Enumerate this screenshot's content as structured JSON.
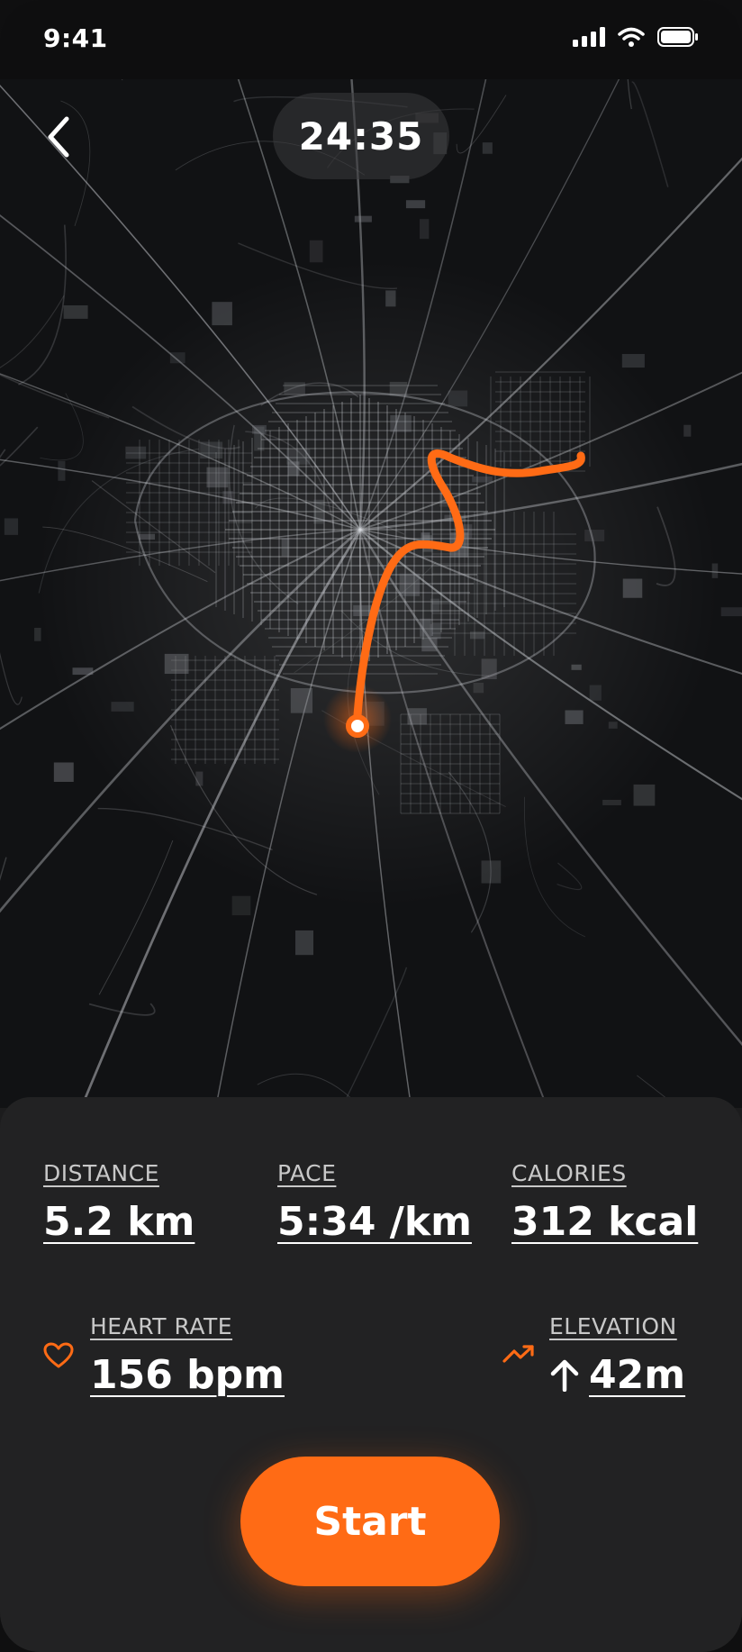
{
  "status_bar": {
    "time": "9:41"
  },
  "header": {
    "timer": "24:35"
  },
  "colors": {
    "accent": "#ff6b15",
    "map_bg": "#111214",
    "sheet_bg": "#222223"
  },
  "icons": [
    "chevron-left-icon",
    "signal-icon",
    "wifi-icon",
    "battery-icon",
    "heart-icon",
    "trending-up-icon",
    "arrow-up-icon"
  ],
  "stats": {
    "distance": {
      "label": "DISTANCE",
      "value": "5.2 km"
    },
    "pace": {
      "label": "PACE",
      "value": "5:34 /km"
    },
    "calories": {
      "label": "CALORIES",
      "value": "312 kcal"
    },
    "heart_rate": {
      "label": "HEART RATE",
      "value": "156 bpm"
    },
    "elevation": {
      "label": "ELEVATION",
      "value": "42m"
    }
  },
  "actions": {
    "start": "Start"
  }
}
